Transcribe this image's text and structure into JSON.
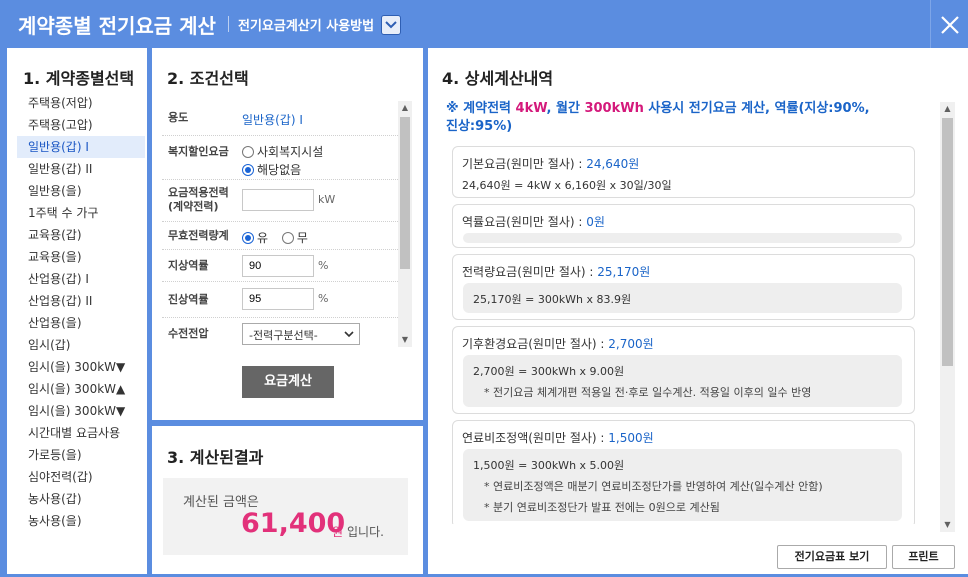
{
  "header": {
    "title": "계약종별 전기요금 계산",
    "guide_link": "전기요금계산기 사용방법"
  },
  "panel1": {
    "title": "1. 계약종별선택",
    "items": [
      "주택용(저압)",
      "주택용(고압)",
      "일반용(갑) I",
      "일반용(갑) II",
      "일반용(을)",
      "1주택 수 가구",
      "교육용(갑)",
      "교육용(을)",
      "산업용(갑) I",
      "산업용(갑) II",
      "산업용(을)",
      "임시(갑)",
      "임시(을) 300kW▼",
      "임시(을) 300kW▲",
      "임시(을) 300kW▼",
      "시간대별 요금사용",
      "가로등(을)",
      "심야전력(갑)",
      "농사용(갑)",
      "농사용(을)"
    ],
    "selected_index": 2
  },
  "panel2": {
    "title": "2. 조건선택",
    "usage_label": "용도",
    "usage_value": "일반용(갑) I",
    "welfare_label": "복지할인요금",
    "welfare_opt1": "사회복지시설",
    "welfare_opt2": "해당없음",
    "contract_label": "요금적용전력(계약전력)",
    "contract_value": "",
    "contract_unit": "kW",
    "reactive_label": "무효전력량계",
    "reactive_opt1": "유",
    "reactive_opt2": "무",
    "lag_label": "지상역률",
    "lag_value": "90",
    "lag_unit": "%",
    "lead_label": "진상역률",
    "lead_value": "95",
    "lead_unit": "%",
    "voltage_label": "수전전압",
    "voltage_select": "-전력구분선택-",
    "calc_button": "요금계산"
  },
  "panel3": {
    "title": "3. 계산된결과",
    "line1": "계산된 금액은",
    "amount": "61,400",
    "won": "원",
    "tail": "입니다."
  },
  "panel4": {
    "title": "4. 상세계산내역",
    "summary": {
      "mark": "※",
      "p1": "계약전력 ",
      "kw": "4kW",
      "p2": ", 월간 ",
      "kwh": "300kWh",
      "p3": " 사용시 전기요금 계산, 역률(지상:90%,",
      "line2": "진상:95%)"
    },
    "basic": {
      "label": "기본요금(원미만 절사) : ",
      "value": "24,640원",
      "formula": "24,640원 = 4kW x 6,160원 x 30일/30일"
    },
    "power_factor": {
      "label": "역률요금(원미만 절사) : ",
      "value": "0원"
    },
    "energy": {
      "label": "전력량요금(원미만 절사) : ",
      "value": "25,170원",
      "formula": "25,170원 = 300kWh x 83.9원"
    },
    "climate": {
      "label": "기후환경요금(원미만 절사) : ",
      "value": "2,700원",
      "formula": "2,700원 = 300kWh x 9.00원",
      "note": "* 전기요금 체계개편 적용일 전·후로 일수계산. 적용일 이후의 일수 반영"
    },
    "fuel": {
      "label": "연료비조정액(원미만 절사) : ",
      "value": "1,500원",
      "formula": "1,500원 = 300kWh x 5.00원",
      "note1": "* 연료비조정액은 매분기 연료비조정단가를 반영하여 계산(일수계산 안함)",
      "note2": "* 분기 연료비조정단가 발표 전에는 0원으로 계산됨"
    },
    "table_button": "전기요금표 보기",
    "print_button": "프린트"
  },
  "colors": {
    "brand": "#5b8de0",
    "link": "#1a64c8",
    "highlight": "#e2317a"
  }
}
